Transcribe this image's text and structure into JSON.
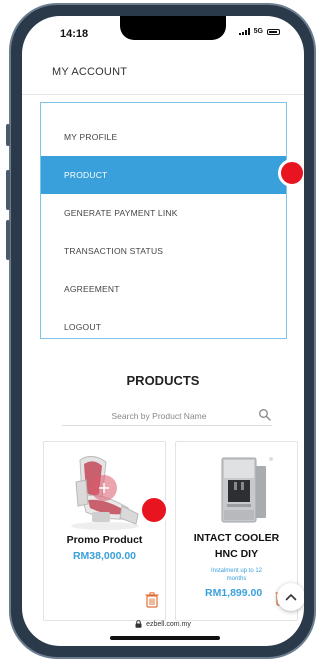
{
  "status_bar": {
    "time": "14:18",
    "network": "5G"
  },
  "header": {
    "title": "MY ACCOUNT"
  },
  "menu": {
    "items": [
      {
        "label": "MY PROFILE",
        "active": false
      },
      {
        "label": "PRODUCT",
        "active": true
      },
      {
        "label": "GENERATE PAYMENT LINK",
        "active": false
      },
      {
        "label": "TRANSACTION STATUS",
        "active": false
      },
      {
        "label": "AGREEMENT",
        "active": false
      },
      {
        "label": "LOGOUT",
        "active": false
      }
    ]
  },
  "products_section": {
    "heading": "PRODUCTS",
    "search_placeholder": "Search by Product Name"
  },
  "products": [
    {
      "name": "Promo Product",
      "price": "RM38,000.00",
      "installment": ""
    },
    {
      "name": "INTACT COOLER HNC DIY",
      "price": "RM1,899.00",
      "installment": "Instalment up to 12 months"
    }
  ],
  "browser": {
    "url": "ezbell.com.my"
  },
  "colors": {
    "accent": "#3aa0db",
    "marker": "#e8141f",
    "trash": "#e0703a"
  }
}
